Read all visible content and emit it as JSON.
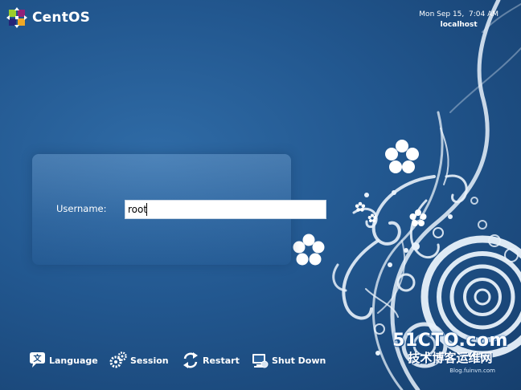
{
  "branding": {
    "logo_text": "CentOS",
    "logo_icon": "centos-pinwheel-icon"
  },
  "header": {
    "datetime": "Mon Sep 15,  7:04 AM",
    "hostname": "localhost"
  },
  "login": {
    "username_label": "Username:",
    "username_value": "root"
  },
  "footer": {
    "language_label": "Language",
    "session_label": "Session",
    "restart_label": "Restart",
    "shutdown_label": "Shut Down"
  },
  "watermark": {
    "site": "51CTO.com",
    "subtitle": "技术博客运维网",
    "blog_fragment": "Blog.fuinvn.com"
  },
  "colors": {
    "background": "#22578f",
    "background_dark": "#163f6e",
    "text": "#ffffff",
    "swirl": "#e8f1fa"
  }
}
